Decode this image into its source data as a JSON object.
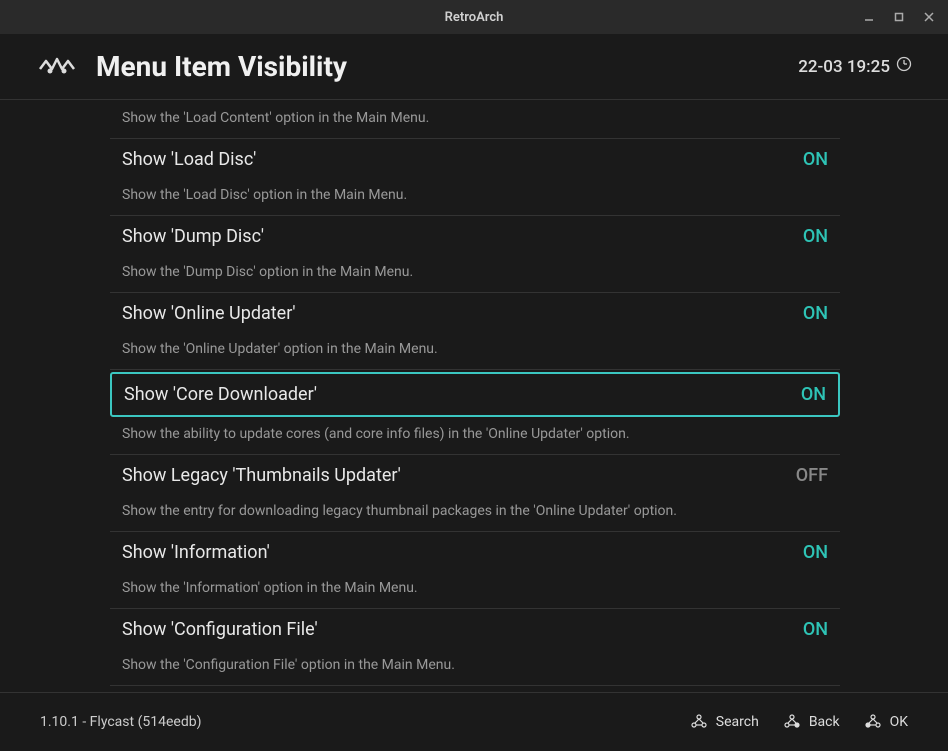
{
  "window": {
    "title": "RetroArch"
  },
  "header": {
    "title": "Menu Item Visibility",
    "clock": "22-03 19:25"
  },
  "orphan_desc": "Show the 'Load Content' option in the Main Menu.",
  "items": [
    {
      "label": "Show 'Load Disc'",
      "value": "ON",
      "on": true,
      "selected": false,
      "desc": "Show the 'Load Disc' option in the Main Menu."
    },
    {
      "label": "Show 'Dump Disc'",
      "value": "ON",
      "on": true,
      "selected": false,
      "desc": "Show the 'Dump Disc' option in the Main Menu."
    },
    {
      "label": "Show 'Online Updater'",
      "value": "ON",
      "on": true,
      "selected": false,
      "desc": "Show the 'Online Updater' option in the Main Menu."
    },
    {
      "label": "Show 'Core Downloader'",
      "value": "ON",
      "on": true,
      "selected": true,
      "desc": "Show the ability to update cores (and core info files) in the 'Online Updater' option."
    },
    {
      "label": "Show Legacy 'Thumbnails Updater'",
      "value": "OFF",
      "on": false,
      "selected": false,
      "desc": "Show the entry for downloading legacy thumbnail packages in the 'Online Updater' option."
    },
    {
      "label": "Show 'Information'",
      "value": "ON",
      "on": true,
      "selected": false,
      "desc": "Show the 'Information' option in the Main Menu."
    },
    {
      "label": "Show 'Configuration File'",
      "value": "ON",
      "on": true,
      "selected": false,
      "desc": "Show the 'Configuration File' option in the Main Menu."
    }
  ],
  "partial_item": {
    "label": "",
    "value": ""
  },
  "footer": {
    "version": "1.10.1 - Flycast (514eedb)",
    "hints": [
      {
        "label": "Search"
      },
      {
        "label": "Back"
      },
      {
        "label": "OK"
      }
    ]
  }
}
